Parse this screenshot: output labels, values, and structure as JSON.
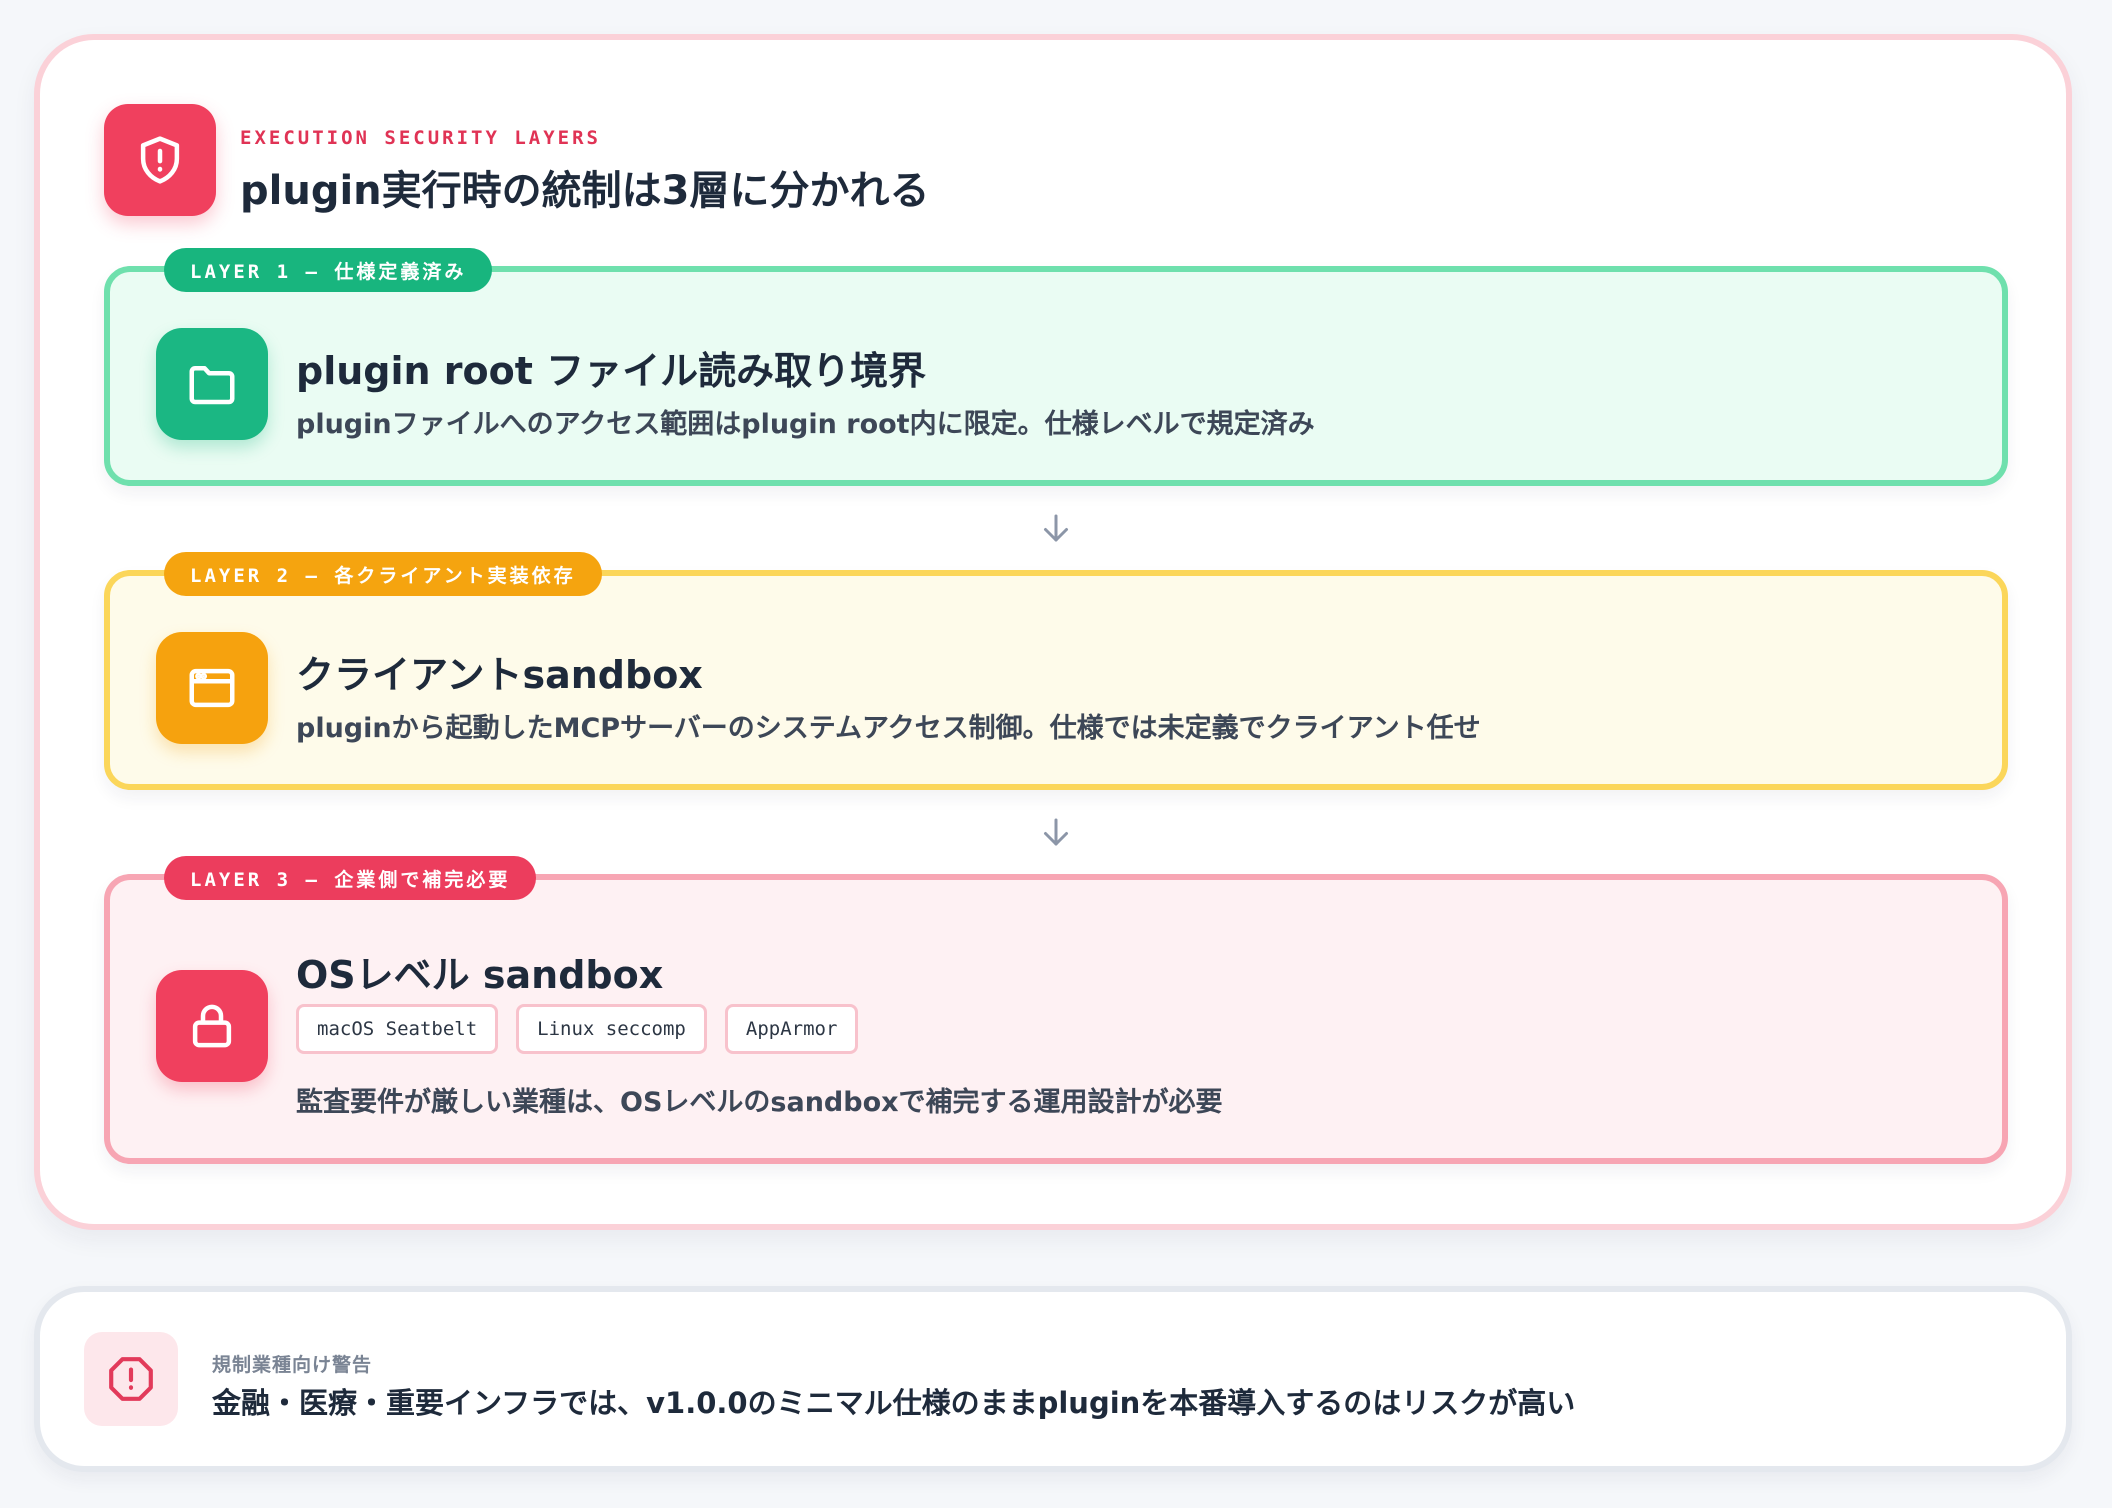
{
  "header": {
    "eyebrow": "EXECUTION SECURITY LAYERS",
    "title": "plugin実行時の統制は3層に分かれる",
    "icon": "shield-alert-icon"
  },
  "layers": [
    {
      "badge": "LAYER 1 — 仕様定義済み",
      "title": "plugin root ファイル読み取り境界",
      "description": "pluginファイルへのアクセス範囲はplugin root内に限定。仕様レベルで規定済み",
      "icon": "folder-icon",
      "accent": "#18b57e"
    },
    {
      "badge": "LAYER 2 — 各クライアント実装依存",
      "title": "クライアントsandbox",
      "description": "pluginから起動したMCPサーバーのシステムアクセス制御。仕様では未定義でクライアント任せ",
      "icon": "browser-window-icon",
      "accent": "#f5a40f"
    },
    {
      "badge": "LAYER 3 — 企業側で補完必要",
      "title": "OSレベル sandbox",
      "tags": [
        "macOS Seatbelt",
        "Linux seccomp",
        "AppArmor"
      ],
      "description": "監査要件が厳しい業種は、OSレベルのsandboxで補完する運用設計が必要",
      "icon": "lock-icon",
      "accent": "#ec3d5d"
    }
  ],
  "warning": {
    "label": "規制業種向け警告",
    "text": "金融・医療・重要インフラでは、v1.0.0のミニマル仕様のままpluginを本番導入するのはリスクが高い",
    "icon": "alert-circle-icon"
  }
}
